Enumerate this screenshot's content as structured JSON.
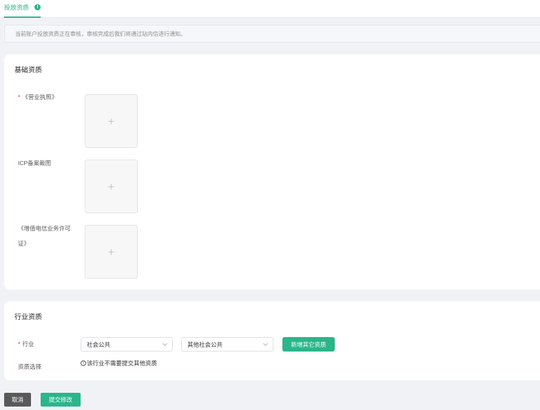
{
  "tabs": [
    {
      "label": "投放资质",
      "active": true,
      "info_icon": "info-icon"
    }
  ],
  "notice": {
    "text": "当前账户投放资质正在审核，审核完成后我们将通过站内信进行通知。"
  },
  "basic_section": {
    "title": "基础资质",
    "fields": [
      {
        "label": "《营业执照》",
        "required": true,
        "required_mark": "*",
        "upload_icon": "plus-icon",
        "upload_glyph": "+"
      },
      {
        "label": "ICP备案截图",
        "required": false,
        "upload_icon": "plus-icon",
        "upload_glyph": "+"
      },
      {
        "label_line1": "《增值电信业务许可",
        "label_line2": "证》",
        "required": false,
        "upload_icon": "plus-icon",
        "upload_glyph": "+"
      }
    ]
  },
  "industry_section": {
    "title": "行业资质",
    "industry_label": "行业",
    "industry_required_mark": "*",
    "select_primary": {
      "value": "社会公共",
      "icon": "chevron-down-icon"
    },
    "select_secondary": {
      "value": "其他社会公共",
      "icon": "chevron-down-icon"
    },
    "add_button_label": "新增其它资质",
    "qualification_label": "资质选择",
    "hint_icon_glyph": "i",
    "hint_text": "该行业不需要提交其他资质"
  },
  "footer": {
    "cancel_label": "取消",
    "submit_label": "提交修改"
  },
  "colors": {
    "accent": "#2bb58a",
    "required": "#f5222d",
    "cancel_button": "#595959",
    "page_background": "#f0f2f5"
  }
}
